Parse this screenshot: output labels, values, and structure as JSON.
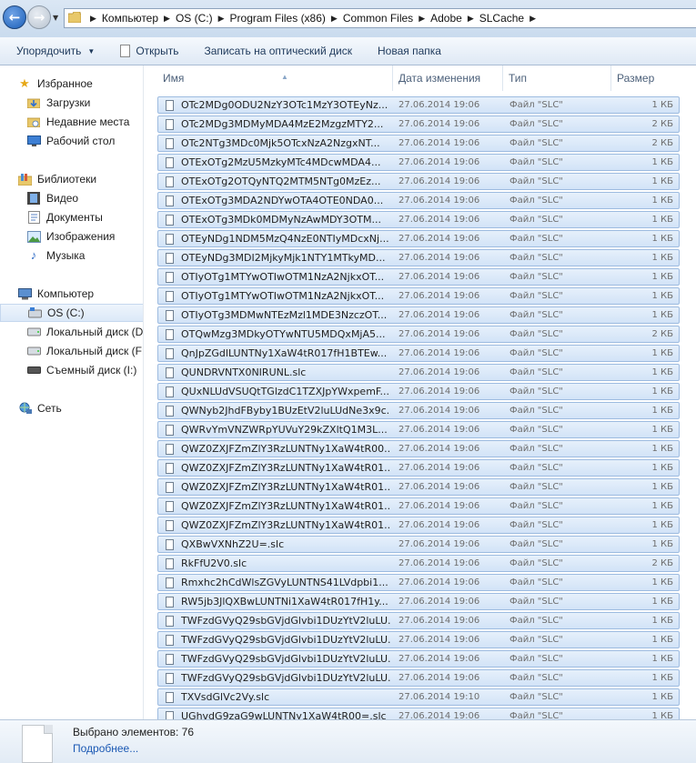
{
  "address_bar": {
    "back_label": "←",
    "forward_label": "→",
    "path": [
      "Компьютер",
      "OS (C:)",
      "Program Files (x86)",
      "Common Files",
      "Adobe",
      "SLCache"
    ]
  },
  "toolbar": {
    "organize": "Упорядочить",
    "open": "Открыть",
    "burn": "Записать на оптический диск",
    "new_folder": "Новая папка"
  },
  "nav": {
    "favorites": "Избранное",
    "downloads": "Загрузки",
    "recent": "Недавние места",
    "desktop": "Рабочий стол",
    "libraries": "Библиотеки",
    "video": "Видео",
    "documents": "Документы",
    "pictures": "Изображения",
    "music": "Музыка",
    "computer": "Компьютер",
    "drive_c": "OS (C:)",
    "local_d": "Локальный диск (D",
    "local_f": "Локальный диск (F:",
    "removable_i": "Съемный диск (I:)",
    "network": "Сеть"
  },
  "columns": {
    "name": "Имя",
    "date": "Дата изменения",
    "type": "Тип",
    "size": "Размер"
  },
  "files": [
    {
      "name": "OTc2MDg0ODU2NzY3OTc1MzY3OTEyNz...",
      "date": "27.06.2014 19:06",
      "type": "Файл \"SLC\"",
      "size": "1 КБ"
    },
    {
      "name": "OTc2MDg3MDMyMDA4MzE2MzgzMTY2...",
      "date": "27.06.2014 19:06",
      "type": "Файл \"SLC\"",
      "size": "2 КБ"
    },
    {
      "name": "OTc2NTg3MDc0Mjk5OTcxNzA2NzgxNT...",
      "date": "27.06.2014 19:06",
      "type": "Файл \"SLC\"",
      "size": "2 КБ"
    },
    {
      "name": "OTExOTg2MzU5MzkyMTc4MDcwMDA4...",
      "date": "27.06.2014 19:06",
      "type": "Файл \"SLC\"",
      "size": "1 КБ"
    },
    {
      "name": "OTExOTg2OTQyNTQ2MTM5NTg0MzEz...",
      "date": "27.06.2014 19:06",
      "type": "Файл \"SLC\"",
      "size": "1 КБ"
    },
    {
      "name": "OTExOTg3MDA2NDYwOTA4OTE0NDA0...",
      "date": "27.06.2014 19:06",
      "type": "Файл \"SLC\"",
      "size": "1 КБ"
    },
    {
      "name": "OTExOTg3MDk0MDMyNzAwMDY3OTM...",
      "date": "27.06.2014 19:06",
      "type": "Файл \"SLC\"",
      "size": "1 КБ"
    },
    {
      "name": "OTEyNDg1NDM5MzQ4NzE0NTIyMDcxNj...",
      "date": "27.06.2014 19:06",
      "type": "Файл \"SLC\"",
      "size": "1 КБ"
    },
    {
      "name": "OTEyNDg3MDI2MjkyMjk1NTY1MTkyMD...",
      "date": "27.06.2014 19:06",
      "type": "Файл \"SLC\"",
      "size": "1 КБ"
    },
    {
      "name": "OTIyOTg1MTYwOTIwOTM1NzA2NjkxOT...",
      "date": "27.06.2014 19:06",
      "type": "Файл \"SLC\"",
      "size": "1 КБ"
    },
    {
      "name": "OTIyOTg1MTYwOTIwOTM1NzA2NjkxOT...",
      "date": "27.06.2014 19:06",
      "type": "Файл \"SLC\"",
      "size": "1 КБ"
    },
    {
      "name": "OTIyOTg3MDMwNTEzMzl1MDE3NzczOT...",
      "date": "27.06.2014 19:06",
      "type": "Файл \"SLC\"",
      "size": "1 КБ"
    },
    {
      "name": "OTQwMzg3MDkyOTYwNTU5MDQxMjA5...",
      "date": "27.06.2014 19:06",
      "type": "Файл \"SLC\"",
      "size": "2 КБ"
    },
    {
      "name": "QnJpZGdlLUNTNy1XaW4tR017fH1BTEw...",
      "date": "27.06.2014 19:06",
      "type": "Файл \"SLC\"",
      "size": "1 КБ"
    },
    {
      "name": "QUNDRVNTX0NIRUNL.slc",
      "date": "27.06.2014 19:06",
      "type": "Файл \"SLC\"",
      "size": "1 КБ"
    },
    {
      "name": "QUxNLUdVSUQtTGlzdC1TZXJpYWxpemF...",
      "date": "27.06.2014 19:06",
      "type": "Файл \"SLC\"",
      "size": "1 КБ"
    },
    {
      "name": "QWNyb2JhdFByby1BUzEtV2luLUdNe3x9c...",
      "date": "27.06.2014 19:06",
      "type": "Файл \"SLC\"",
      "size": "1 КБ"
    },
    {
      "name": "QWRvYmVNZWRpYUVuY29kZXltQ1M3L...",
      "date": "27.06.2014 19:06",
      "type": "Файл \"SLC\"",
      "size": "1 КБ"
    },
    {
      "name": "QWZ0ZXJFZmZlY3RzLUNTNy1XaW4tR00...",
      "date": "27.06.2014 19:06",
      "type": "Файл \"SLC\"",
      "size": "1 КБ"
    },
    {
      "name": "QWZ0ZXJFZmZlY3RzLUNTNy1XaW4tR01...",
      "date": "27.06.2014 19:06",
      "type": "Файл \"SLC\"",
      "size": "1 КБ"
    },
    {
      "name": "QWZ0ZXJFZmZlY3RzLUNTNy1XaW4tR01...",
      "date": "27.06.2014 19:06",
      "type": "Файл \"SLC\"",
      "size": "1 КБ"
    },
    {
      "name": "QWZ0ZXJFZmZlY3RzLUNTNy1XaW4tR01...",
      "date": "27.06.2014 19:06",
      "type": "Файл \"SLC\"",
      "size": "1 КБ"
    },
    {
      "name": "QWZ0ZXJFZmZlY3RzLUNTNy1XaW4tR01...",
      "date": "27.06.2014 19:06",
      "type": "Файл \"SLC\"",
      "size": "1 КБ"
    },
    {
      "name": "QXBwVXNhZ2U=.slc",
      "date": "27.06.2014 19:06",
      "type": "Файл \"SLC\"",
      "size": "1 КБ"
    },
    {
      "name": "RkFfU2V0.slc",
      "date": "27.06.2014 19:06",
      "type": "Файл \"SLC\"",
      "size": "2 КБ"
    },
    {
      "name": "Rmxhc2hCdWlsZGVyLUNTNS41LVdpbi1...",
      "date": "27.06.2014 19:06",
      "type": "Файл \"SLC\"",
      "size": "1 КБ"
    },
    {
      "name": "RW5jb3JlQXBwLUNTNi1XaW4tR017fH1y...",
      "date": "27.06.2014 19:06",
      "type": "Файл \"SLC\"",
      "size": "1 КБ"
    },
    {
      "name": "TWFzdGVyQ29sbGVjdGlvbi1DUzYtV2luLU...",
      "date": "27.06.2014 19:06",
      "type": "Файл \"SLC\"",
      "size": "1 КБ"
    },
    {
      "name": "TWFzdGVyQ29sbGVjdGlvbi1DUzYtV2luLU...",
      "date": "27.06.2014 19:06",
      "type": "Файл \"SLC\"",
      "size": "1 КБ"
    },
    {
      "name": "TWFzdGVyQ29sbGVjdGlvbi1DUzYtV2luLU...",
      "date": "27.06.2014 19:06",
      "type": "Файл \"SLC\"",
      "size": "1 КБ"
    },
    {
      "name": "TWFzdGVyQ29sbGVjdGlvbi1DUzYtV2luLU...",
      "date": "27.06.2014 19:06",
      "type": "Файл \"SLC\"",
      "size": "1 КБ"
    },
    {
      "name": "TXVsdGlVc2Vy.slc",
      "date": "27.06.2014 19:10",
      "type": "Файл \"SLC\"",
      "size": "1 КБ"
    },
    {
      "name": "UGhvdG9zaG9wLUNTNy1XaW4tR00=.slc",
      "date": "27.06.2014 19:06",
      "type": "Файл \"SLC\"",
      "size": "1 КБ"
    }
  ],
  "details": {
    "selected": "Выбрано элементов: 76",
    "more": "Подробнее..."
  }
}
